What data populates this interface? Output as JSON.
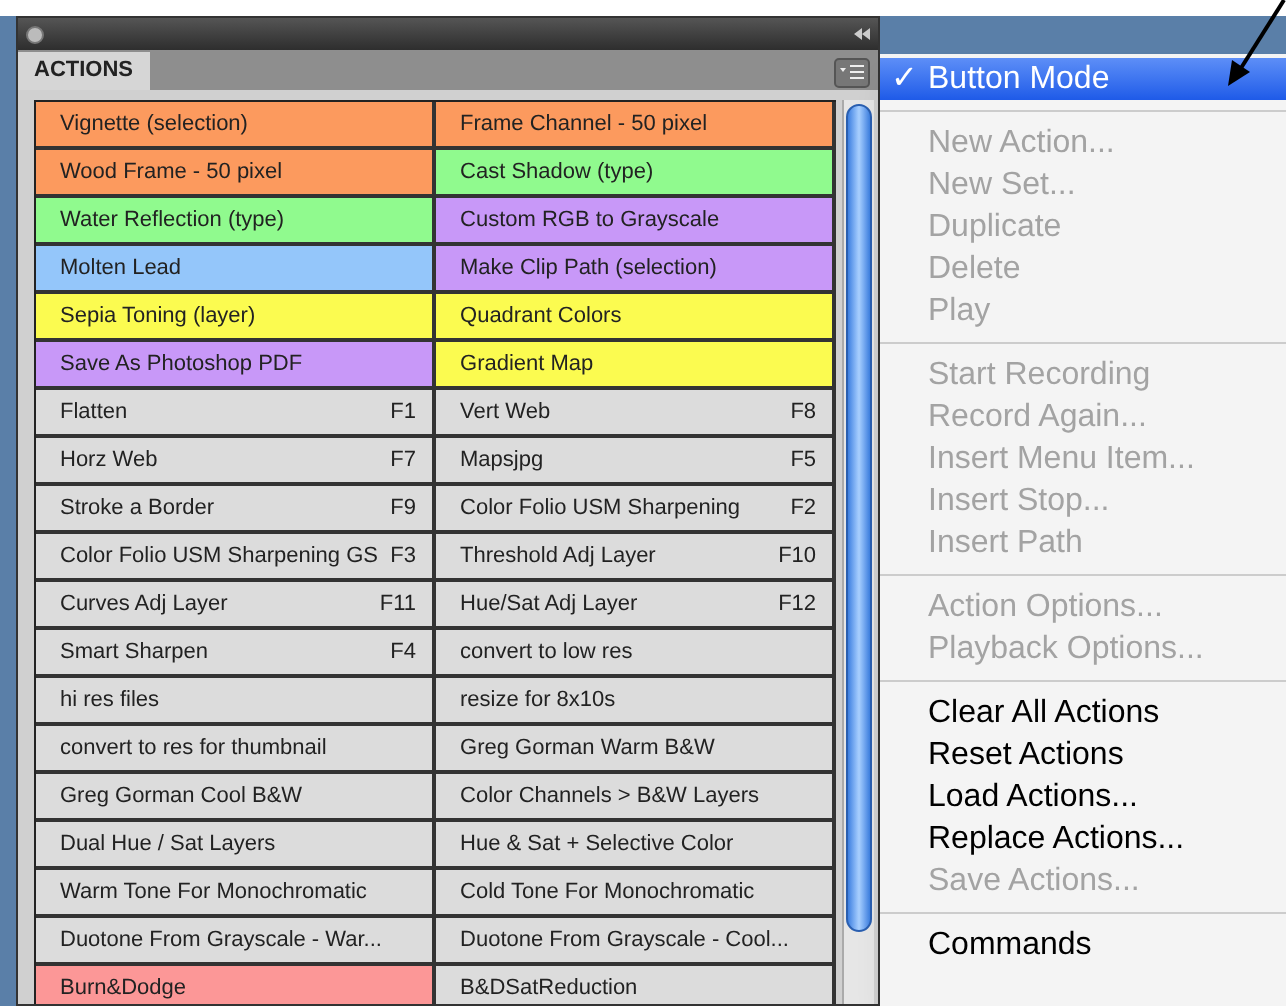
{
  "panel": {
    "tab": "ACTIONS",
    "actions": [
      {
        "label": "Vignette (selection)",
        "color": "#fc9a5e"
      },
      {
        "label": "Frame Channel - 50 pixel",
        "color": "#fc9a5e"
      },
      {
        "label": "Wood Frame - 50 pixel",
        "color": "#fc9a5e"
      },
      {
        "label": "Cast Shadow (type)",
        "color": "#90fa8e"
      },
      {
        "label": "Water Reflection (type)",
        "color": "#90fa8e"
      },
      {
        "label": "Custom RGB to Grayscale",
        "color": "#c898f8"
      },
      {
        "label": "Molten Lead",
        "color": "#94c6fa"
      },
      {
        "label": "Make Clip Path (selection)",
        "color": "#c898f8"
      },
      {
        "label": "Sepia Toning (layer)",
        "color": "#fbfb50"
      },
      {
        "label": "Quadrant Colors",
        "color": "#fbfb50"
      },
      {
        "label": "Save As Photoshop PDF",
        "color": "#c898f8"
      },
      {
        "label": "Gradient Map",
        "color": "#fbfb50"
      },
      {
        "label": "Flatten",
        "shortcut": "F1",
        "color": "#dcdcdc"
      },
      {
        "label": "Vert Web",
        "shortcut": "F8",
        "color": "#dcdcdc"
      },
      {
        "label": "Horz Web",
        "shortcut": "F7",
        "color": "#dcdcdc"
      },
      {
        "label": "Mapsjpg",
        "shortcut": "F5",
        "color": "#dcdcdc"
      },
      {
        "label": "Stroke a Border",
        "shortcut": "F9",
        "color": "#dcdcdc"
      },
      {
        "label": "Color Folio USM Sharpening",
        "shortcut": "F2",
        "color": "#dcdcdc"
      },
      {
        "label": "Color Folio USM Sharpening GS",
        "shortcut": "F3",
        "color": "#dcdcdc"
      },
      {
        "label": "Threshold Adj Layer",
        "shortcut": "F10",
        "color": "#dcdcdc"
      },
      {
        "label": "Curves Adj Layer",
        "shortcut": "F11",
        "color": "#dcdcdc"
      },
      {
        "label": "Hue/Sat Adj Layer",
        "shortcut": "F12",
        "color": "#dcdcdc"
      },
      {
        "label": "Smart Sharpen",
        "shortcut": "F4",
        "color": "#dcdcdc"
      },
      {
        "label": "convert to low res",
        "color": "#dcdcdc"
      },
      {
        "label": "hi res files",
        "color": "#dcdcdc"
      },
      {
        "label": "resize for 8x10s",
        "color": "#dcdcdc"
      },
      {
        "label": "convert to res for thumbnail",
        "color": "#dcdcdc"
      },
      {
        "label": "Greg Gorman Warm B&W",
        "color": "#dcdcdc"
      },
      {
        "label": "Greg Gorman Cool B&W",
        "color": "#dcdcdc"
      },
      {
        "label": "Color Channels > B&W Layers",
        "color": "#dcdcdc"
      },
      {
        "label": "Dual Hue / Sat Layers",
        "color": "#dcdcdc"
      },
      {
        "label": "Hue & Sat + Selective Color",
        "color": "#dcdcdc"
      },
      {
        "label": "Warm Tone For Monochromatic",
        "color": "#dcdcdc"
      },
      {
        "label": "Cold Tone For Monochromatic",
        "color": "#dcdcdc"
      },
      {
        "label": "Duotone From Grayscale - War...",
        "color": "#dcdcdc"
      },
      {
        "label": "Duotone From Grayscale - Cool...",
        "color": "#dcdcdc"
      },
      {
        "label": "Burn&Dodge",
        "color": "#fc9797"
      },
      {
        "label": "B&DSatReduction",
        "color": "#dcdcdc"
      }
    ]
  },
  "menu": {
    "check_mark": "✓",
    "items": [
      {
        "kind": "item",
        "label": "Button Mode",
        "checked": true,
        "highlighted": true,
        "disabled": false
      },
      {
        "kind": "separator"
      },
      {
        "kind": "item",
        "label": "New Action...",
        "checked": false,
        "highlighted": false,
        "disabled": true
      },
      {
        "kind": "item",
        "label": "New Set...",
        "checked": false,
        "highlighted": false,
        "disabled": true
      },
      {
        "kind": "item",
        "label": "Duplicate",
        "checked": false,
        "highlighted": false,
        "disabled": true
      },
      {
        "kind": "item",
        "label": "Delete",
        "checked": false,
        "highlighted": false,
        "disabled": true
      },
      {
        "kind": "item",
        "label": "Play",
        "checked": false,
        "highlighted": false,
        "disabled": true
      },
      {
        "kind": "separator"
      },
      {
        "kind": "item",
        "label": "Start Recording",
        "checked": false,
        "highlighted": false,
        "disabled": true
      },
      {
        "kind": "item",
        "label": "Record Again...",
        "checked": false,
        "highlighted": false,
        "disabled": true
      },
      {
        "kind": "item",
        "label": "Insert Menu Item...",
        "checked": false,
        "highlighted": false,
        "disabled": true
      },
      {
        "kind": "item",
        "label": "Insert Stop...",
        "checked": false,
        "highlighted": false,
        "disabled": true
      },
      {
        "kind": "item",
        "label": "Insert Path",
        "checked": false,
        "highlighted": false,
        "disabled": true
      },
      {
        "kind": "separator"
      },
      {
        "kind": "item",
        "label": "Action Options...",
        "checked": false,
        "highlighted": false,
        "disabled": true
      },
      {
        "kind": "item",
        "label": "Playback Options...",
        "checked": false,
        "highlighted": false,
        "disabled": true
      },
      {
        "kind": "separator"
      },
      {
        "kind": "item",
        "label": "Clear All Actions",
        "checked": false,
        "highlighted": false,
        "disabled": false
      },
      {
        "kind": "item",
        "label": "Reset Actions",
        "checked": false,
        "highlighted": false,
        "disabled": false
      },
      {
        "kind": "item",
        "label": "Load Actions...",
        "checked": false,
        "highlighted": false,
        "disabled": false
      },
      {
        "kind": "item",
        "label": "Replace Actions...",
        "checked": false,
        "highlighted": false,
        "disabled": false
      },
      {
        "kind": "item",
        "label": "Save Actions...",
        "checked": false,
        "highlighted": false,
        "disabled": true
      },
      {
        "kind": "separator"
      },
      {
        "kind": "item",
        "label": "Commands",
        "checked": false,
        "highlighted": false,
        "disabled": false
      }
    ]
  }
}
